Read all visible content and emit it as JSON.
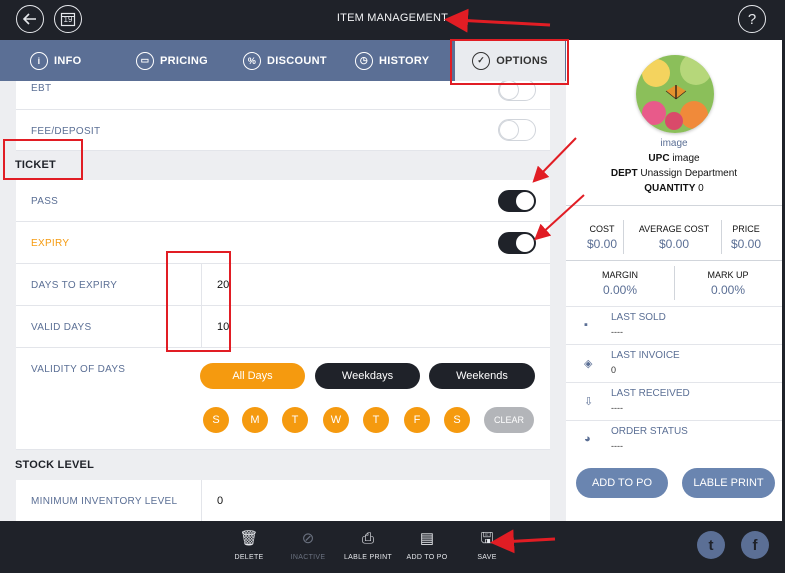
{
  "header": {
    "title": "ITEM MANAGEMENT",
    "calendar_day": "19",
    "help": "?"
  },
  "tabs": [
    {
      "label": "INFO",
      "icon": "info-icon"
    },
    {
      "label": "PRICING",
      "icon": "pricing-icon"
    },
    {
      "label": "DISCOUNT",
      "icon": "percent-icon"
    },
    {
      "label": "HISTORY",
      "icon": "clock-icon"
    },
    {
      "label": "OPTIONS",
      "icon": "check-icon",
      "active": true
    }
  ],
  "options": {
    "ebt": {
      "label": "EBT",
      "on": false
    },
    "fee_deposit": {
      "label": "FEE/DEPOSIT",
      "on": false
    },
    "ticket_section": "TICKET",
    "pass": {
      "label": "PASS",
      "on": true
    },
    "expiry": {
      "label": "EXPIRY",
      "on": true
    },
    "days_to_expiry": {
      "label": "DAYS TO EXPIRY",
      "value": "20"
    },
    "valid_days": {
      "label": "VALID DAYS",
      "value": "10"
    },
    "validity": {
      "label": "VALIDITY OF DAYS",
      "modes": [
        "All Days",
        "Weekdays",
        "Weekends"
      ],
      "selected_mode": "All Days",
      "days": [
        "S",
        "M",
        "T",
        "W",
        "T",
        "F",
        "S"
      ],
      "clear_label": "CLEAR"
    },
    "stock_section": "STOCK LEVEL",
    "min_inventory": {
      "label": "MINIMUM INVENTORY LEVEL",
      "value": "0"
    }
  },
  "item": {
    "image_link": "image",
    "upc_label": "UPC",
    "upc_value": "image",
    "dept_label": "DEPT",
    "dept_value": "Unassign Department",
    "qty_label": "QUANTITY",
    "qty_value": "0",
    "cost_label": "COST",
    "cost_value": "$0.00",
    "avg_cost_label": "AVERAGE COST",
    "avg_cost_value": "$0.00",
    "price_label": "PRICE",
    "price_value": "$0.00",
    "margin_label": "MARGIN",
    "margin_value": "0.00%",
    "markup_label": "MARK UP",
    "markup_value": "0.00%"
  },
  "activity": [
    {
      "label": "LAST SOLD",
      "value": "----",
      "icon": "bag-icon"
    },
    {
      "label": "LAST INVOICE",
      "value": "0",
      "icon": "layers-icon"
    },
    {
      "label": "LAST RECEIVED",
      "value": "----",
      "icon": "download-icon"
    },
    {
      "label": "ORDER STATUS",
      "value": "----",
      "icon": "pie-icon"
    }
  ],
  "right_buttons": {
    "add_to_po": "ADD TO PO",
    "label_print": "LABLE PRINT"
  },
  "bottom_bar": [
    {
      "label": "DELETE",
      "icon": "trash-icon",
      "enabled": true
    },
    {
      "label": "INACTIVE",
      "icon": "inactive-icon",
      "enabled": false
    },
    {
      "label": "LABLE PRINT",
      "icon": "printer-icon",
      "enabled": true
    },
    {
      "label": "ADD TO PO",
      "icon": "po-icon",
      "enabled": true
    },
    {
      "label": "SAVE",
      "icon": "save-icon",
      "enabled": true
    }
  ],
  "colors": {
    "dark": "#1f2229",
    "accent": "#f59a0f",
    "tab_bar": "#5b6f95",
    "annotation": "#e11d24"
  }
}
